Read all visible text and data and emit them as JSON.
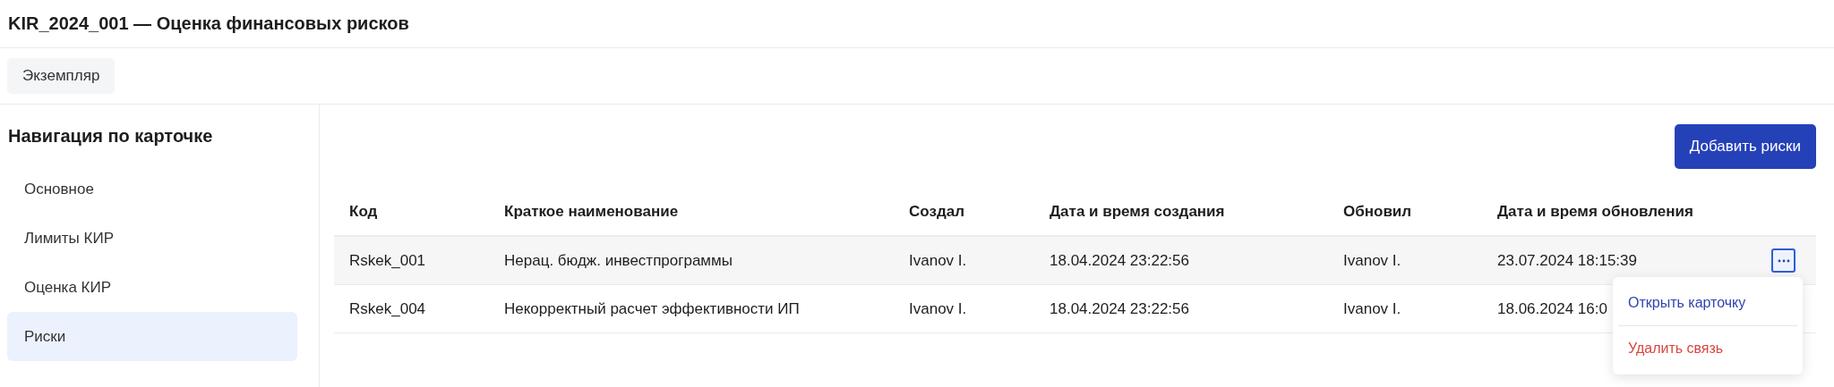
{
  "window": {
    "title": "KIR_2024_001 — Оценка финансовых рисков"
  },
  "tabs": [
    {
      "label": "Экземпляр"
    }
  ],
  "sidebar": {
    "title": "Навигация по карточке",
    "items": [
      {
        "label": "Основное",
        "selected": false
      },
      {
        "label": "Лимиты КИР",
        "selected": false
      },
      {
        "label": "Оценка КИР",
        "selected": false
      },
      {
        "label": "Риски",
        "selected": true
      }
    ]
  },
  "add_button": "Добавить риски",
  "table": {
    "columns": [
      "Код",
      "Краткое наименование",
      "Создал",
      "Дата и время создания",
      "Обновил",
      "Дата и время обновления"
    ],
    "rows": [
      {
        "cells": [
          "Rskek_001",
          "Нерац. бюдж. инвестпрограммы",
          "Ivanov I.",
          "18.04.2024 23:22:56",
          "Ivanov I.",
          "23.07.2024 18:15:39"
        ],
        "hovered": true,
        "menu": {
          "items": [
            {
              "label": "Открыть карточку",
              "kind": "default"
            },
            {
              "label": "Удалить связь",
              "kind": "danger"
            }
          ]
        }
      },
      {
        "cells": [
          "Rskek_004",
          "Некорректный расчет эффективности ИП",
          "Ivanov I.",
          "18.04.2024 23:22:56",
          "Ivanov I.",
          "18.06.2024 16:0"
        ]
      }
    ]
  }
}
